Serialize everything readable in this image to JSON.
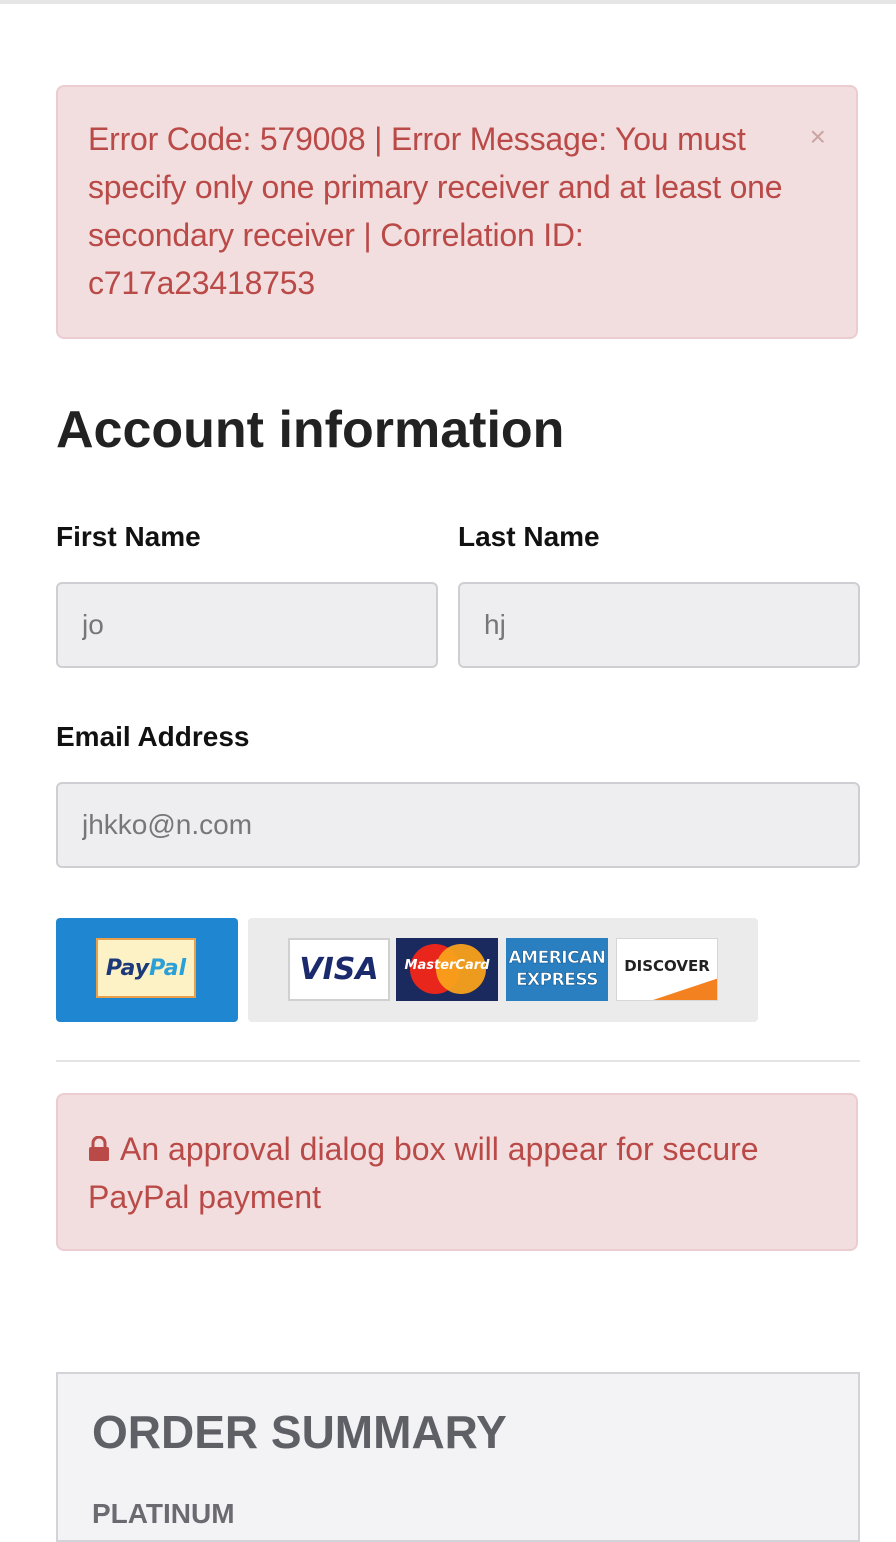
{
  "error_alert": {
    "message": "Error Code: 579008 | Error Message: You must specify only one primary receiver and at least one secondary receiver | Correlation ID: c717a23418753",
    "close_label": "×"
  },
  "account": {
    "heading": "Account information",
    "first_name": {
      "label": "First Name",
      "value": "jo"
    },
    "last_name": {
      "label": "Last Name",
      "value": "hj"
    },
    "email": {
      "label": "Email Address",
      "value": "jhkko@n.com"
    }
  },
  "payment": {
    "paypal_logo": {
      "part1": "Pay",
      "part2": "Pal"
    },
    "cards": {
      "visa": "VISA",
      "mastercard": "MasterCard",
      "amex_line1": "AMERICAN",
      "amex_line2": "EXPRESS",
      "discover": "DISCOVER"
    }
  },
  "approval_notice": {
    "icon": "lock-icon",
    "text": "An approval dialog box will appear for secure PayPal payment"
  },
  "order_summary": {
    "title": "ORDER SUMMARY",
    "item": "PLATINUM"
  },
  "colors": {
    "alert_bg": "#f2dede",
    "alert_text": "#b94a48",
    "paypal_blue": "#1f86d1"
  }
}
